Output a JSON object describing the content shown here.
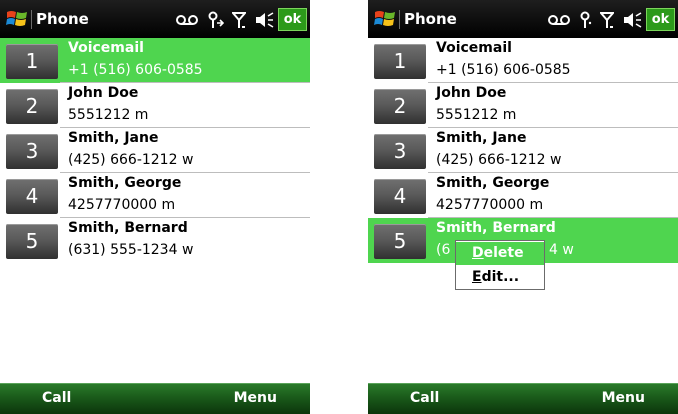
{
  "screens": [
    {
      "title": "Phone",
      "ok_label": "ok",
      "contacts": [
        {
          "number": "1",
          "name": "Voicemail",
          "detail": "+1 (516) 606-0585",
          "selected": true
        },
        {
          "number": "2",
          "name": "John Doe",
          "detail": "5551212 m",
          "selected": false
        },
        {
          "number": "3",
          "name": "Smith, Jane",
          "detail": "(425) 666-1212 w",
          "selected": false
        },
        {
          "number": "4",
          "name": "Smith, George",
          "detail": "4257770000 m",
          "selected": false
        },
        {
          "number": "5",
          "name": "Smith, Bernard",
          "detail": "(631) 555-1234 w",
          "selected": false
        }
      ],
      "softkeys": {
        "left": "Call",
        "right": "Menu"
      }
    },
    {
      "title": "Phone",
      "ok_label": "ok",
      "contacts": [
        {
          "number": "1",
          "name": "Voicemail",
          "detail": "+1 (516) 606-0585",
          "selected": false
        },
        {
          "number": "2",
          "name": "John Doe",
          "detail": "5551212 m",
          "selected": false
        },
        {
          "number": "3",
          "name": "Smith, Jane",
          "detail": "(425) 666-1212 w",
          "selected": false
        },
        {
          "number": "4",
          "name": "Smith, George",
          "detail": "4257770000 m",
          "selected": false
        },
        {
          "number": "5",
          "name": "Smith, Bernard",
          "detail_visible_left": "(6",
          "detail_visible_right": "4 w",
          "selected": true
        }
      ],
      "context_menu": {
        "items": [
          {
            "hotkey": "D",
            "rest": "elete"
          },
          {
            "hotkey": "E",
            "rest": "dit..."
          }
        ]
      },
      "softkeys": {
        "left": "Call",
        "right": "Menu"
      }
    }
  ],
  "icons": [
    "windows-start-icon",
    "voicemail-icon",
    "connectivity-icon",
    "signal-icon",
    "speaker-icon"
  ],
  "colors": {
    "selection_green": "#4fd54f",
    "ok_green": "#2c9a1a",
    "softbar_green": "#1a5a1a",
    "titlebar_black": "#000000"
  }
}
